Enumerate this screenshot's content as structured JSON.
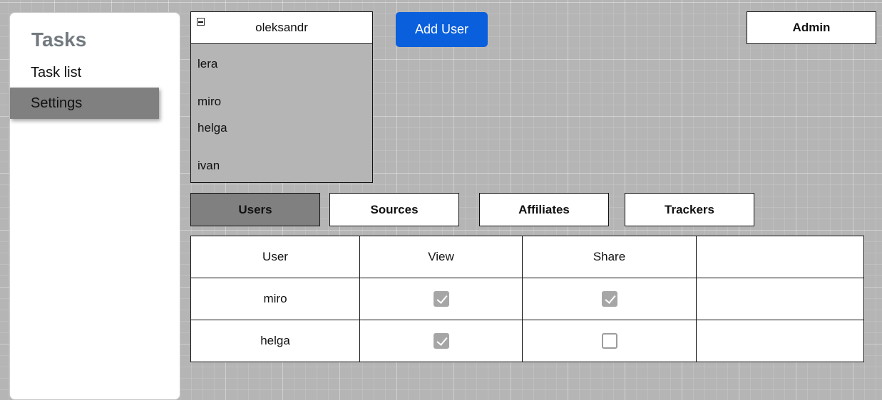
{
  "sidebar": {
    "title": "Tasks",
    "items": [
      {
        "label": "Task list",
        "active": false
      },
      {
        "label": "Settings",
        "active": true
      }
    ]
  },
  "user_panel": {
    "title": "oleksandr",
    "users": [
      "lera",
      "miro",
      "helga",
      "ivan"
    ]
  },
  "buttons": {
    "add_user": "Add User",
    "admin": "Admin"
  },
  "tabs": [
    {
      "label": "Users",
      "active": true
    },
    {
      "label": "Sources",
      "active": false
    },
    {
      "label": "Affiliates",
      "active": false
    },
    {
      "label": "Trackers",
      "active": false
    }
  ],
  "table": {
    "headers": [
      "User",
      "View",
      "Share",
      ""
    ],
    "rows": [
      {
        "user": "miro",
        "view": true,
        "share": true
      },
      {
        "user": "helga",
        "view": true,
        "share": false
      }
    ]
  },
  "colors": {
    "accent": "#0a5fdc",
    "active_tab": "#808080",
    "background": "#b5b5b5"
  }
}
